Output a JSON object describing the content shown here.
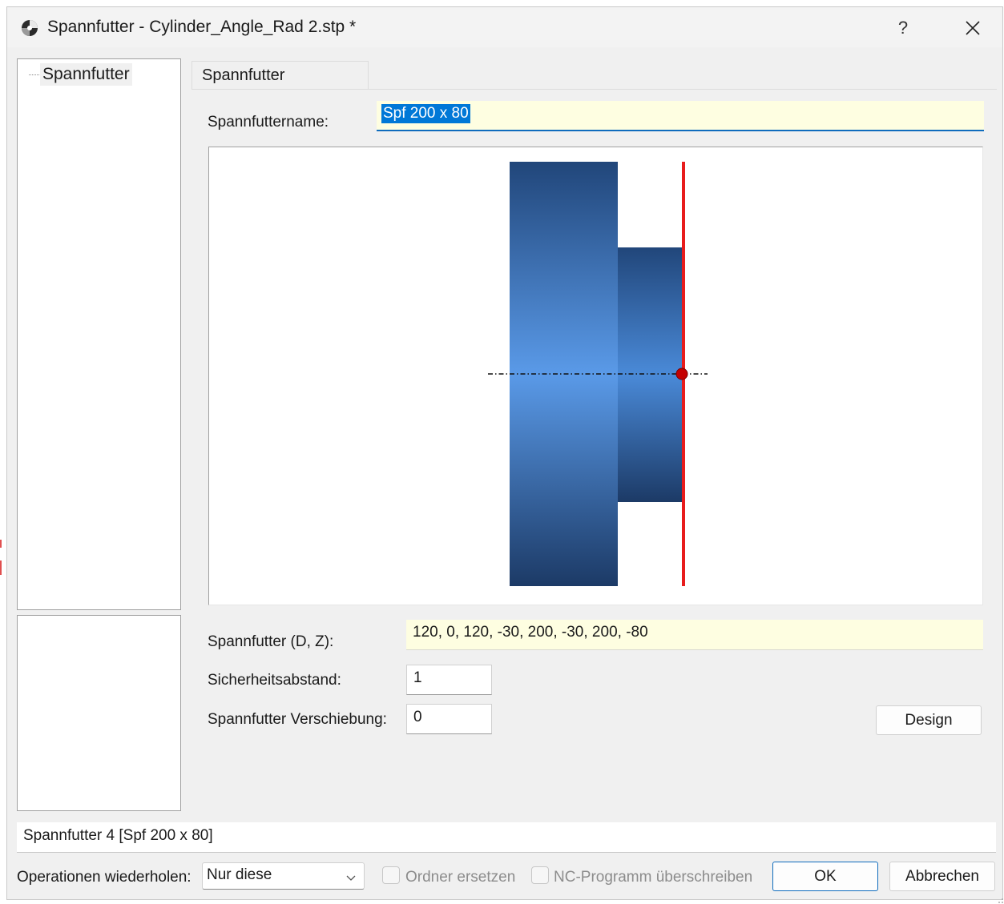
{
  "window": {
    "title": "Spannfutter - Cylinder_Angle_Rad 2.stp *",
    "help_label": "?",
    "close_icon": "close-icon"
  },
  "tree": {
    "items": [
      {
        "label": "Spannfutter"
      }
    ]
  },
  "tab": {
    "label": "Spannfutter"
  },
  "form": {
    "name_label": "Spannfuttername:",
    "name_value": "Spf 200 x 80",
    "profile_label": "Spannfutter (D, Z):",
    "profile_value": "120, 0, 120, -30, 200, -30, 200, -80",
    "safety_label": "Sicherheitsabstand:",
    "safety_value": "1",
    "shift_label": "Spannfutter Verschiebung:",
    "shift_value": "0",
    "design_button": "Design"
  },
  "preview": {
    "chuck_color_dark": "#1f3f6e",
    "chuck_color_light": "#5a9ae8",
    "face_line_color": "#e81c1c",
    "origin_marker_color": "#c40000"
  },
  "status_bar": {
    "text": "Spannfutter 4 [Spf 200 x 80]"
  },
  "footer": {
    "repeat_label": "Operationen wiederholen:",
    "repeat_value": "Nur diese",
    "replace_folder_label": "Ordner ersetzen",
    "overwrite_nc_label": "NC-Programm überschreiben",
    "ok_button": "OK",
    "cancel_button": "Abbrechen"
  }
}
